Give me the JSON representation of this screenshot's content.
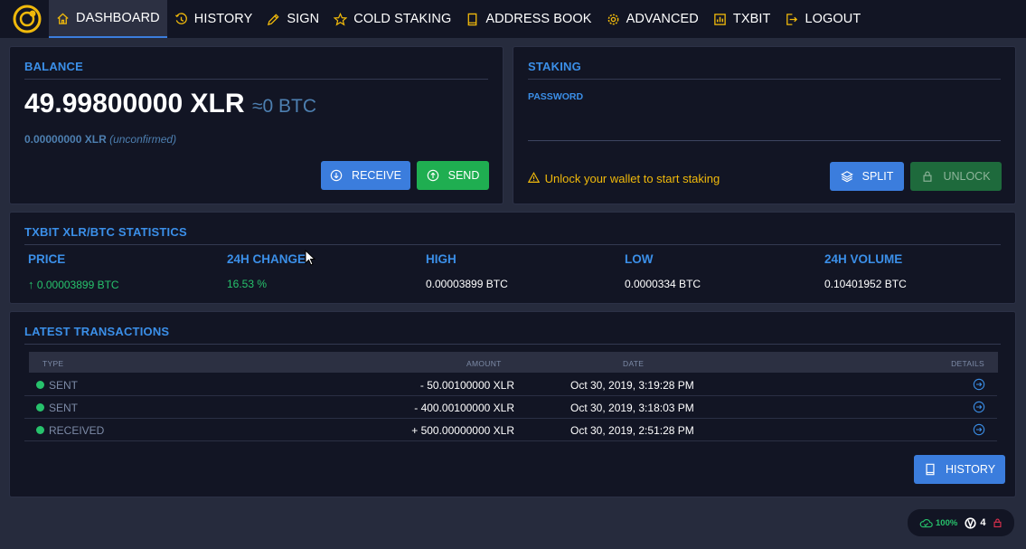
{
  "nav": {
    "items": [
      {
        "label": "DASHBOARD",
        "icon": "home-icon"
      },
      {
        "label": "HISTORY",
        "icon": "history-icon"
      },
      {
        "label": "SIGN",
        "icon": "pencil-icon"
      },
      {
        "label": "COLD STAKING",
        "icon": "star-icon"
      },
      {
        "label": "ADDRESS BOOK",
        "icon": "book-icon"
      },
      {
        "label": "ADVANCED",
        "icon": "gear-icon"
      },
      {
        "label": "TXBIT",
        "icon": "chart-icon"
      },
      {
        "label": "LOGOUT",
        "icon": "logout-icon"
      }
    ]
  },
  "balance": {
    "title": "BALANCE",
    "amount": "49.99800000 XLR",
    "btc": "≈0 BTC",
    "unconfirmed_amount": "0.00000000 XLR",
    "unconfirmed_label": "(unconfirmed)",
    "receive_label": "RECEIVE",
    "send_label": "SEND"
  },
  "staking": {
    "title": "STAKING",
    "password_label": "PASSWORD",
    "password_value": "",
    "warning": "Unlock your wallet to start staking",
    "split_label": "SPLIT",
    "unlock_label": "UNLOCK"
  },
  "stats": {
    "title": "TXBIT XLR/BTC STATISTICS",
    "items": [
      {
        "label": "PRICE",
        "value": "0.00003899 BTC"
      },
      {
        "label": "24H CHANGE",
        "value": "16.53 %"
      },
      {
        "label": "HIGH",
        "value": "0.00003899 BTC"
      },
      {
        "label": "LOW",
        "value": "0.0000334 BTC"
      },
      {
        "label": "24H VOLUME",
        "value": "0.10401952 BTC"
      }
    ]
  },
  "transactions": {
    "title": "LATEST TRANSACTIONS",
    "headers": {
      "type": "TYPE",
      "amount": "AMOUNT",
      "date": "DATE",
      "details": "DETAILS"
    },
    "rows": [
      {
        "type": "SENT",
        "amount": "- 50.00100000 XLR",
        "date": "Oct 30, 2019, 3:19:28 PM"
      },
      {
        "type": "SENT",
        "amount": "- 400.00100000 XLR",
        "date": "Oct 30, 2019, 3:18:03 PM"
      },
      {
        "type": "RECEIVED",
        "amount": "+ 500.00000000 XLR",
        "date": "Oct 30, 2019, 2:51:28 PM"
      }
    ],
    "history_label": "HISTORY"
  },
  "status": {
    "sync": "100%",
    "peers": "4"
  },
  "colors": {
    "accent": "#3b7ddd",
    "positive": "#1fae51",
    "warning": "#f0b90b"
  }
}
